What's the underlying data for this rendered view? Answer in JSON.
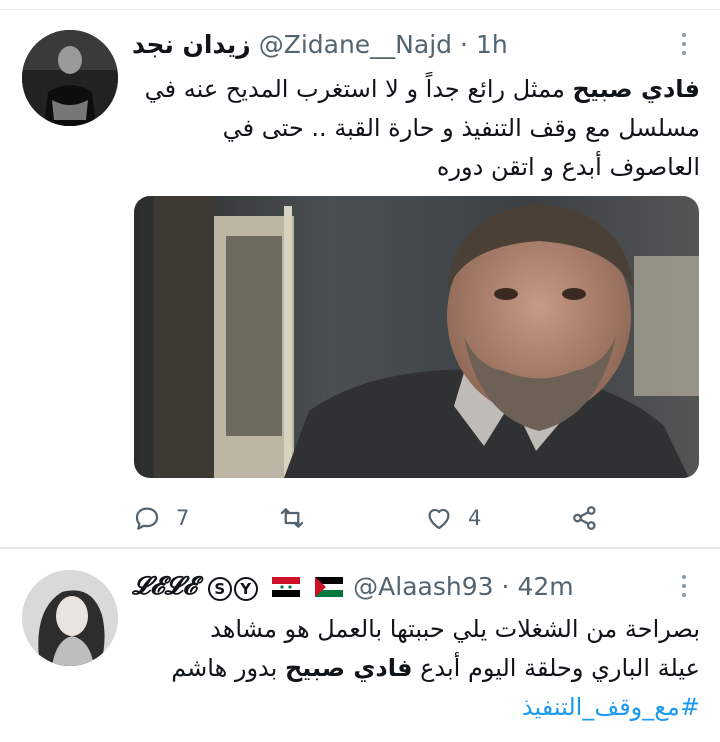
{
  "tweets": [
    {
      "display_name": "زيدان نجد",
      "handle": "@Zidane__Najd",
      "separator": "·",
      "time": "1h",
      "text_bold": "فادي صبيح",
      "text_rest": " ممثل رائع جداً و لا استغرب  المديح عنه في مسلسل مع وقف التنفيذ و حارة القبة .. حتى في العاصوف أبدع و اتقن دوره",
      "actions": {
        "reply_icon": "reply-icon",
        "reply_count": "7",
        "retweet_icon": "retweet-icon",
        "retweet_count": "",
        "like_icon": "like-icon",
        "like_count": "4",
        "share_icon": "share-icon"
      }
    },
    {
      "display_name_prefix": "𝓛𝓔𝓛𝓔",
      "badge_s": "S",
      "badge_y": "Y",
      "flags": [
        "syria-flag",
        "palestine-flag"
      ],
      "handle": "@Alaash93",
      "separator": "·",
      "time": "42m",
      "text_line1": "بصراحة من الشغلات يلي حببتها بالعمل هو مشاهد",
      "text_line2_pre": "عيلة الباري وحلقة اليوم أبدع ",
      "text_bold": "فادي صبيح",
      "text_line2_post": " بدور هاشم",
      "hashtag": "#مع_وقف_التنفيذ"
    }
  ],
  "colors": {
    "accent": "#1d9bf0",
    "text": "#0f1419",
    "muted": "#536471",
    "divider": "#e6e9ec"
  }
}
